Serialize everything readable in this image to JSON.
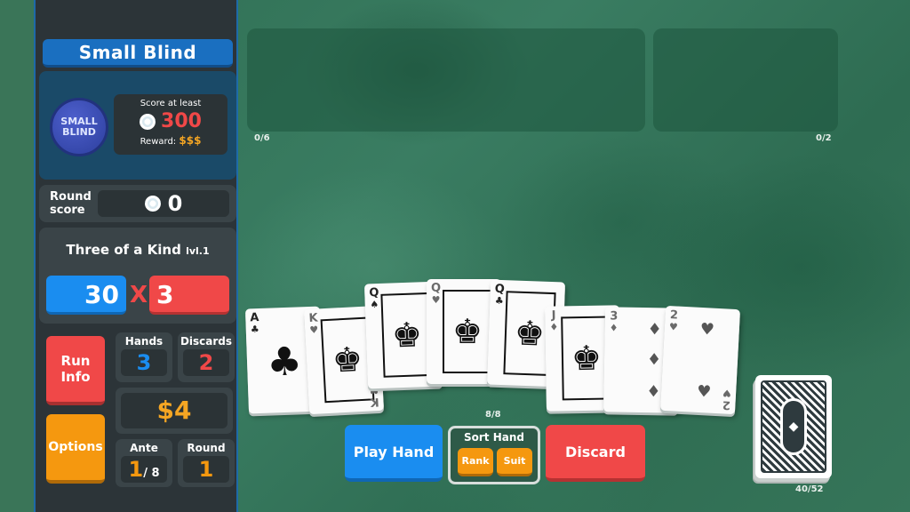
{
  "blind": {
    "title": "Small Blind",
    "chip_line1": "SMALL",
    "chip_line2": "BLIND",
    "score_label": "Score at least",
    "score_target": "300",
    "reward_label": "Reward:",
    "reward_value": "$$$"
  },
  "round_score": {
    "label_line1": "Round",
    "label_line2": "score",
    "value": "0"
  },
  "hand": {
    "name": "Three of a Kind",
    "level": "lvl.1",
    "chips": "30",
    "times": "X",
    "mult": "3"
  },
  "buttons": {
    "run_info_line1": "Run",
    "run_info_line2": "Info",
    "options": "Options",
    "play_hand": "Play Hand",
    "discard": "Discard",
    "sort_hand": "Sort Hand",
    "sort_rank": "Rank",
    "sort_suit": "Suit"
  },
  "stats": {
    "hands_label": "Hands",
    "hands_value": "3",
    "discards_label": "Discards",
    "discards_value": "2",
    "money": "$4",
    "ante_label": "Ante",
    "ante_value": "1",
    "ante_max": "/ 8",
    "round_label": "Round",
    "round_value": "1"
  },
  "slots": {
    "jokers_count": "0/6",
    "consumables_count": "0/2"
  },
  "hand_count": "8/8",
  "deck_count": "40/52",
  "colors": {
    "chips_blue": "#1a8df0",
    "mult_red": "#f04848",
    "money_gold": "#f5a623",
    "options_orange": "#f5980f",
    "felt_green": "#35745a",
    "sidebar_dark": "#2c3438"
  },
  "cards": [
    {
      "rank": "A",
      "suit": "♣",
      "suit_name": "clubs",
      "type": "pip"
    },
    {
      "rank": "K",
      "suit": "♥",
      "suit_name": "hearts",
      "type": "face"
    },
    {
      "rank": "Q",
      "suit": "♠",
      "suit_name": "spades",
      "type": "face"
    },
    {
      "rank": "Q",
      "suit": "♥",
      "suit_name": "hearts",
      "type": "face"
    },
    {
      "rank": "Q",
      "suit": "♣",
      "suit_name": "clubs",
      "type": "face"
    },
    {
      "rank": "J",
      "suit": "♦",
      "suit_name": "diamonds",
      "type": "face"
    },
    {
      "rank": "3",
      "suit": "♦",
      "suit_name": "diamonds",
      "type": "pip"
    },
    {
      "rank": "2",
      "suit": "♥",
      "suit_name": "hearts",
      "type": "pip"
    }
  ],
  "face_glyph": "♚"
}
